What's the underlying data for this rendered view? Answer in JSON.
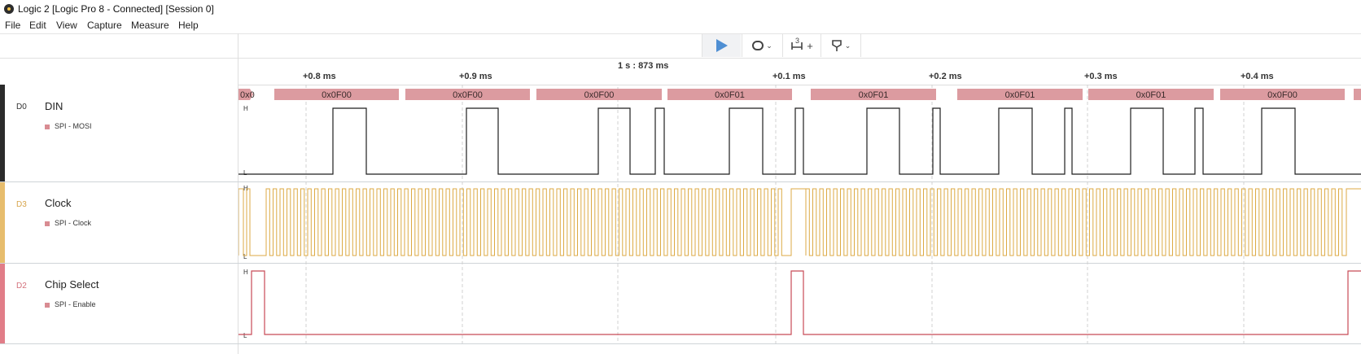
{
  "window": {
    "title": "Logic 2 [Logic Pro 8 - Connected] [Session 0]"
  },
  "menu": {
    "items": [
      "File",
      "Edit",
      "View",
      "Capture",
      "Measure",
      "Help"
    ]
  },
  "toolbar": {
    "measure_count": "3",
    "measure_plus": "+"
  },
  "timeline": {
    "center_label": "1 s : 873 ms",
    "ticks": [
      "+0.8 ms",
      "+0.9 ms",
      "+0.1 ms",
      "+0.2 ms",
      "+0.3 ms",
      "+0.4 ms"
    ]
  },
  "channels": [
    {
      "id": "D0",
      "name": "DIN",
      "analyzer": "SPI - MOSI",
      "color": "#2b2b2b",
      "trace_color": "#1e1e1e"
    },
    {
      "id": "D3",
      "name": "Clock",
      "analyzer": "SPI - Clock",
      "color": "#e7bd6d",
      "trace_color": "#dcaa44"
    },
    {
      "id": "D2",
      "name": "Chip Select",
      "analyzer": "SPI - Enable",
      "color": "#e17d88",
      "trace_color": "#c84a56"
    }
  ],
  "level_labels": {
    "high": "H",
    "low": "L"
  },
  "decoded_frames": [
    "0x0",
    "0x0F00",
    "0x0F00",
    "0x0F00",
    "0x0F01",
    "0x0F01",
    "0x0F01",
    "0x0F01",
    "0x0F00"
  ],
  "colors": {
    "frame_fill": "#dc9ba0",
    "frame_text": "#3a2a2a",
    "accent_play": "#4f8fd3"
  }
}
